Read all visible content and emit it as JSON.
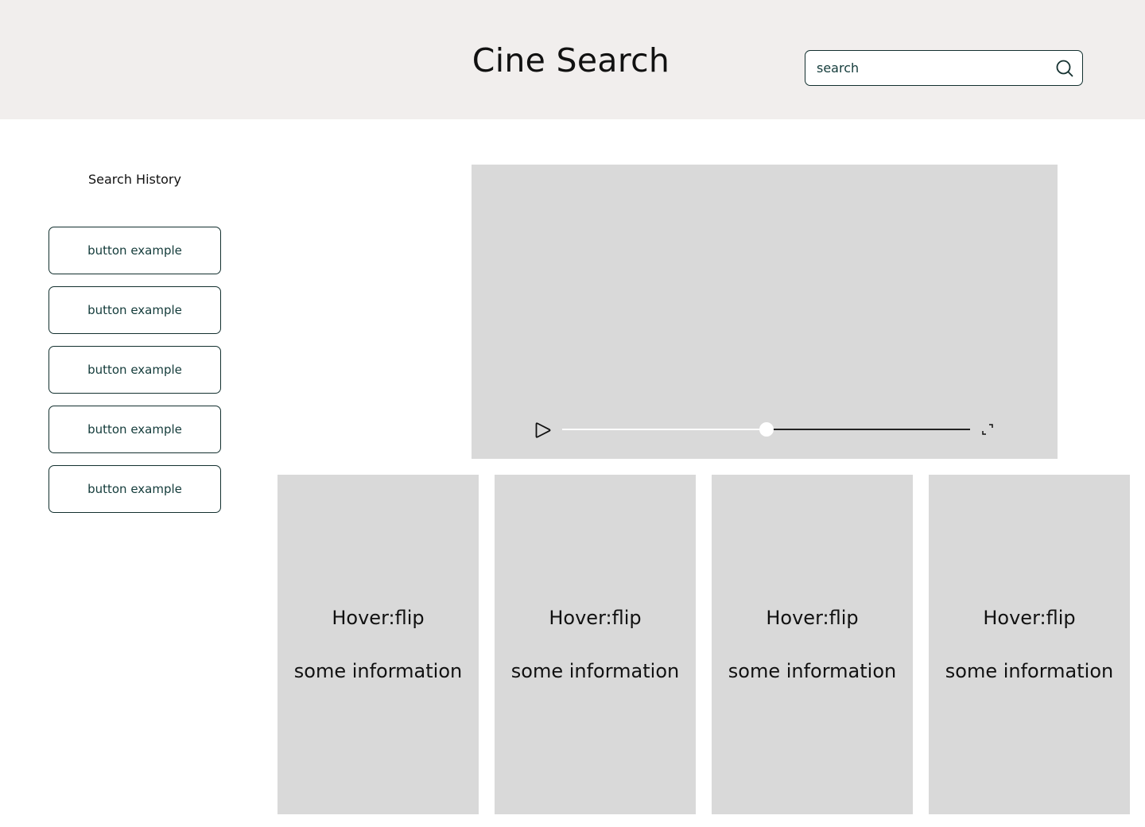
{
  "header": {
    "title": "Cine Search",
    "search": {
      "placeholder": "search",
      "value": "",
      "icon": "search-icon"
    }
  },
  "sidebar": {
    "title": "Search History",
    "items": [
      {
        "label": "button example"
      },
      {
        "label": "button example"
      },
      {
        "label": "button example"
      },
      {
        "label": "button example"
      },
      {
        "label": "button example"
      }
    ]
  },
  "player": {
    "progress": 0.5,
    "controls": {
      "play_icon": "play-icon",
      "fullscreen_icon": "fullscreen-icon"
    }
  },
  "cards": [
    {
      "title": "Hover:flip",
      "info": "some information"
    },
    {
      "title": "Hover:flip",
      "info": "some information"
    },
    {
      "title": "Hover:flip",
      "info": "some information"
    },
    {
      "title": "Hover:flip",
      "info": "some information"
    }
  ],
  "colors": {
    "header_bg": "#f1eeed",
    "placeholder_gray": "#d9d9d9",
    "outline_dark": "#13302f",
    "button_text": "#133b3a"
  }
}
